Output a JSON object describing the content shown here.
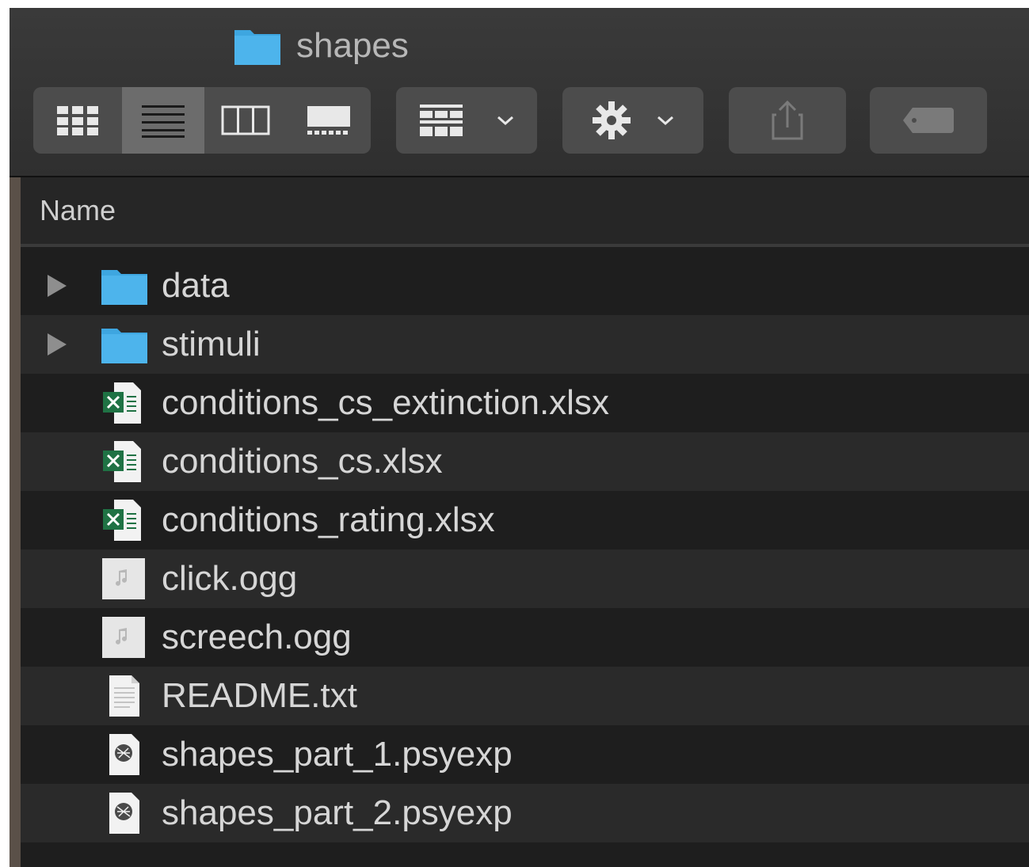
{
  "window": {
    "title": "shapes",
    "colors": {
      "toolbar": "#333333",
      "list_bg": "#1e1e1e",
      "row_alt": "#2a2a2a",
      "folder_blue": "#3ea6e0",
      "excel_green": "#1f7244",
      "text": "#d6d6d6"
    }
  },
  "toolbar": {
    "view_modes": [
      {
        "name": "icon-view",
        "icon": "grid-icon",
        "selected": false
      },
      {
        "name": "list-view",
        "icon": "list-icon",
        "selected": true
      },
      {
        "name": "column-view",
        "icon": "columns-icon",
        "selected": false
      },
      {
        "name": "gallery-view",
        "icon": "gallery-icon",
        "selected": false
      }
    ],
    "group_button": {
      "icon": "group-icon",
      "has_menu": true
    },
    "action_button": {
      "icon": "gear-icon",
      "has_menu": true
    },
    "share_button": {
      "icon": "share-icon"
    },
    "tag_button": {
      "icon": "tag-icon"
    }
  },
  "list": {
    "column_header": "Name",
    "items": [
      {
        "name": "data",
        "kind": "folder",
        "expandable": true
      },
      {
        "name": "stimuli",
        "kind": "folder",
        "expandable": true
      },
      {
        "name": "conditions_cs_extinction.xlsx",
        "kind": "excel",
        "expandable": false
      },
      {
        "name": "conditions_cs.xlsx",
        "kind": "excel",
        "expandable": false
      },
      {
        "name": "conditions_rating.xlsx",
        "kind": "excel",
        "expandable": false
      },
      {
        "name": "click.ogg",
        "kind": "audio",
        "expandable": false
      },
      {
        "name": "screech.ogg",
        "kind": "audio",
        "expandable": false
      },
      {
        "name": "README.txt",
        "kind": "text",
        "expandable": false
      },
      {
        "name": "shapes_part_1.psyexp",
        "kind": "psyexp",
        "expandable": false
      },
      {
        "name": "shapes_part_2.psyexp",
        "kind": "psyexp",
        "expandable": false
      }
    ]
  }
}
